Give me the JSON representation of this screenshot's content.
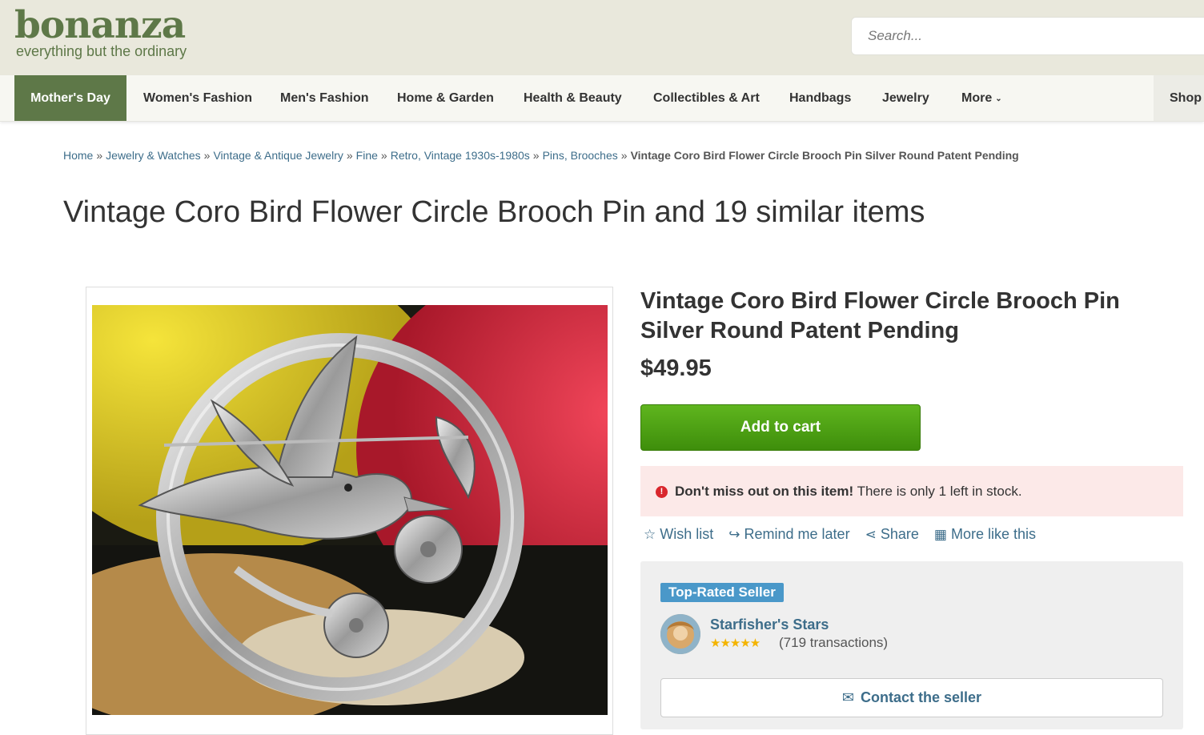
{
  "header": {
    "logo_text": "bonanza",
    "tagline": "everything but the ordinary",
    "search_placeholder": "Search..."
  },
  "nav": {
    "items": [
      {
        "label": "Mother's Day"
      },
      {
        "label": "Women's Fashion"
      },
      {
        "label": "Men's Fashion"
      },
      {
        "label": "Home & Garden"
      },
      {
        "label": "Health & Beauty"
      },
      {
        "label": "Collectibles & Art"
      },
      {
        "label": "Handbags"
      },
      {
        "label": "Jewelry"
      },
      {
        "label": "More"
      }
    ],
    "shop_label": "Shop b"
  },
  "breadcrumb": {
    "items": [
      "Home",
      "Jewelry & Watches",
      "Vintage & Antique Jewelry",
      "Fine",
      "Retro, Vintage 1930s-1980s",
      "Pins, Brooches"
    ],
    "separator": "»",
    "current": "Vintage Coro Bird Flower Circle Brooch Pin Silver Round Patent Pending"
  },
  "page_title": "Vintage Coro Bird Flower Circle Brooch Pin and 19 similar items",
  "product": {
    "title": "Vintage Coro Bird Flower Circle Brooch Pin Silver Round Patent Pending",
    "price": "$49.95",
    "add_to_cart": "Add to cart",
    "alert_icon": "!",
    "alert_bold": "Don't miss out on this item!",
    "alert_text": " There is only 1 left in stock.",
    "actions": {
      "wish_list": "Wish list",
      "remind": "Remind me later",
      "share": "Share",
      "more_like": "More like this"
    }
  },
  "seller": {
    "badge": "Top-Rated Seller",
    "name": "Starfisher's Stars",
    "rating": 5,
    "stars_text": "★★★★★",
    "transactions": "(719 transactions)",
    "contact": "Contact the seller"
  },
  "colors": {
    "brand_green": "#5e7848",
    "link_blue": "#3d6d8a",
    "cart_green": "#4ca314",
    "alert_bg": "#fce9e8",
    "badge_blue": "#4a98c9"
  },
  "icons": [
    "star-outline-icon",
    "remind-icon",
    "share-icon",
    "grid-icon",
    "envelope-icon",
    "alert-exclamation-icon",
    "chevron-down-icon"
  ]
}
